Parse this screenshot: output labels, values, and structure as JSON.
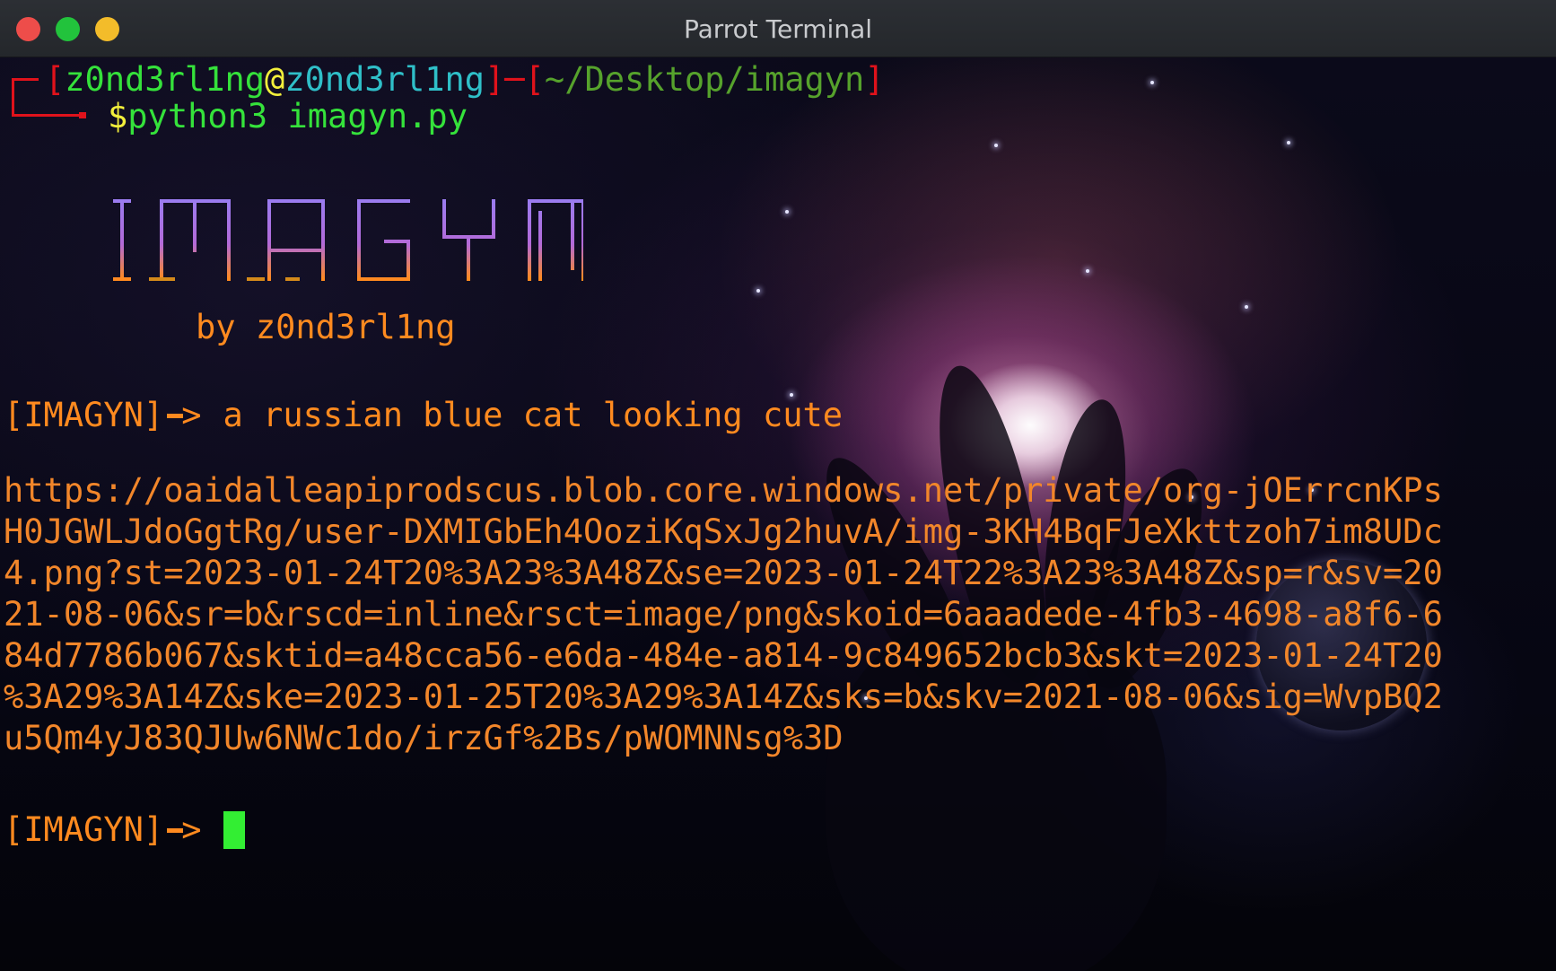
{
  "window": {
    "title": "Parrot Terminal"
  },
  "prompt": {
    "bracket_open": "┌─[",
    "user": "z0nd3rl1ng",
    "at": "@",
    "host": "z0nd3rl1ng",
    "bracket_mid": "]─[",
    "path": "~/Desktop/imagyn",
    "bracket_close": "]",
    "dollar": "$",
    "command": "python3 imagyn.py"
  },
  "banner": {
    "logo_text": "IMAGYN",
    "byline": "by z0nd3rl1ng"
  },
  "session": {
    "prompt_label": "[IMAGYN]",
    "first_input": "a russian blue cat looking cute",
    "output_lines": [
      "https://oaidalleapiprodscus.blob.core.windows.net/private/org-jOErrcnKPs",
      "H0JGWLJdoGgtRg/user-DXMIGbEh4OoziKqSxJg2huvA/img-3KH4BqFJeXkttzoh7im8UDc",
      "4.png?st=2023-01-24T20%3A23%3A48Z&se=2023-01-24T22%3A23%3A48Z&sp=r&sv=20",
      "21-08-06&sr=b&rscd=inline&rsct=image/png&skoid=6aaadede-4fb3-4698-a8f6-6",
      "84d7786b067&sktid=a48cca56-e6da-484e-a814-9c849652bcb3&skt=2023-01-24T20",
      "%3A29%3A14Z&ske=2023-01-25T20%3A29%3A14Z&sks=b&skv=2021-08-06&sig=WvpBQ2",
      "u5Qm4yJ83QJUw6NWc1do/irzGf%2Bs/pWOMNNsg%3D"
    ],
    "second_input": ""
  },
  "colors": {
    "prompt_red": "#e0121b",
    "prompt_green": "#35e23b",
    "prompt_cyan": "#2fbfc8",
    "command_yellow": "#f2ef3b",
    "path_green": "#56a22c",
    "imagyn_orange": "#ff8a1f",
    "cursor_green": "#33ee33"
  },
  "icons": {
    "prompt_arrow": "arrow-right-icon",
    "window_close": "close-icon",
    "window_minimize": "minimize-icon",
    "window_maximize": "maximize-icon"
  }
}
